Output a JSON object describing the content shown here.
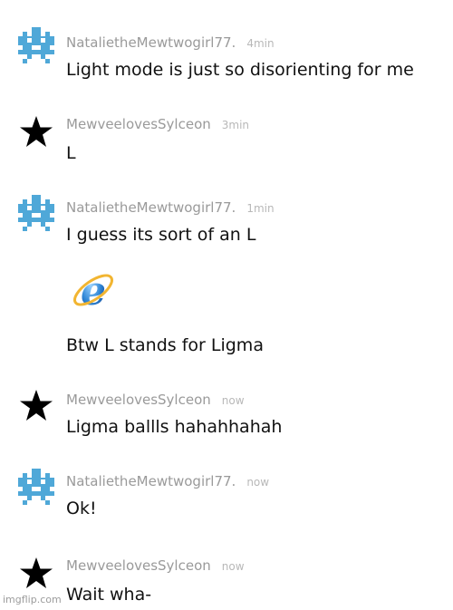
{
  "messages": [
    {
      "user": "NatalietheMewtwogirl77.",
      "time": "4min",
      "text": "Light mode is just so disorienting for me",
      "avatar": "pixel-mewtwo-icon"
    },
    {
      "user": "MewveelovesSylceon",
      "time": "3min",
      "text": "L",
      "avatar": "black-star-icon"
    },
    {
      "user": "NatalietheMewtwogirl77.",
      "time": "1min",
      "text": "I guess its sort of an L",
      "avatar": "pixel-mewtwo-icon"
    },
    {
      "text": "Btw L stands for Ligma",
      "attachment": "internet-explorer-icon"
    },
    {
      "user": "MewveelovesSylceon",
      "time": "now",
      "text": "Ligma ballls hahahhahah",
      "avatar": "black-star-icon"
    },
    {
      "user": "NatalietheMewtwogirl77.",
      "time": "now",
      "text": "Ok!",
      "avatar": "pixel-mewtwo-icon"
    },
    {
      "user": "MewveelovesSylceon",
      "time": "now",
      "text": "Wait wha-",
      "avatar": "black-star-icon"
    }
  ],
  "watermark": "imgflip.com",
  "colors": {
    "pixel_avatar": "#4fa8d8",
    "star": "#000000",
    "username": "#9a9a9a",
    "timestamp": "#b8b8b8",
    "message_text": "#111111"
  }
}
